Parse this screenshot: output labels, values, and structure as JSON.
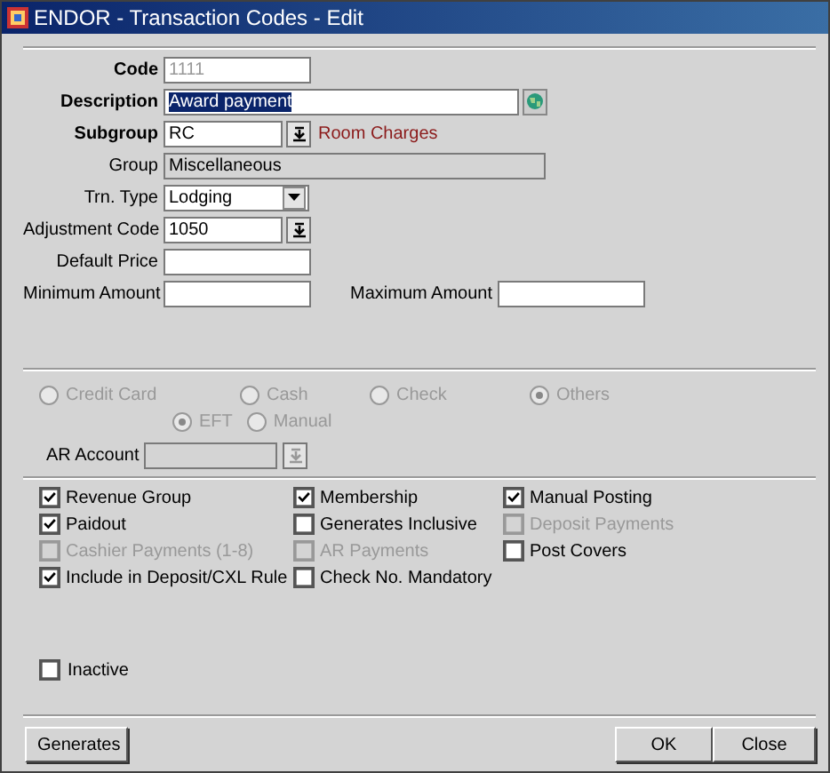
{
  "window": {
    "title": "ENDOR - Transaction Codes - Edit"
  },
  "fields": [
    {
      "kind": "text",
      "label": "Code",
      "required": true,
      "value": "1111",
      "disabled": true
    },
    {
      "kind": "translate",
      "label": "Description",
      "required": true,
      "value": "Award payment",
      "highlighted": true
    },
    {
      "kind": "lov",
      "label": "Subgroup",
      "required": true,
      "value": "RC",
      "note": "Room Charges"
    },
    {
      "kind": "readonly",
      "label": "Group",
      "required": false,
      "value": "Miscellaneous"
    },
    {
      "kind": "select",
      "label": "Trn. Type",
      "required": false,
      "value": "Lodging"
    },
    {
      "kind": "lov",
      "label": "Adjustment Code",
      "required": false,
      "value": "1050"
    },
    {
      "kind": "text",
      "label": "Default Price",
      "required": false
    }
  ],
  "amounts": [
    {
      "label": "Minimum Amount"
    },
    {
      "label": "Maximum Amount"
    }
  ],
  "payment_types": [
    {
      "label": "Credit Card",
      "selected": false
    },
    {
      "label": "Cash",
      "selected": false
    },
    {
      "label": "Check",
      "selected": false
    },
    {
      "label": "Others",
      "selected": true
    }
  ],
  "others_types": [
    {
      "label": "EFT",
      "selected": true
    },
    {
      "label": "Manual",
      "selected": false
    }
  ],
  "ar_account": {
    "label": "AR Account",
    "disabled": true
  },
  "options": [
    {
      "label": "Revenue Group",
      "checked": true,
      "disabled": false
    },
    {
      "label": "Membership",
      "checked": true,
      "disabled": false
    },
    {
      "label": "Manual Posting",
      "checked": true,
      "disabled": false
    },
    {
      "label": "Paidout",
      "checked": true,
      "disabled": false
    },
    {
      "label": "Generates Inclusive",
      "checked": false,
      "disabled": false
    },
    {
      "label": "Deposit Payments",
      "checked": false,
      "disabled": true
    },
    {
      "label": "Cashier Payments (1-8)",
      "checked": false,
      "disabled": true
    },
    {
      "label": "AR Payments",
      "checked": false,
      "disabled": true
    },
    {
      "label": "Post Covers",
      "checked": false,
      "disabled": false
    },
    {
      "label": "Include in Deposit/CXL Rule",
      "checked": true,
      "disabled": false
    },
    {
      "label": "Check No. Mandatory",
      "checked": false,
      "disabled": false
    }
  ],
  "inactive": {
    "label": "Inactive",
    "checked": false
  },
  "buttons": {
    "left": [
      "Generates"
    ],
    "right": [
      "OK",
      "Close"
    ]
  }
}
